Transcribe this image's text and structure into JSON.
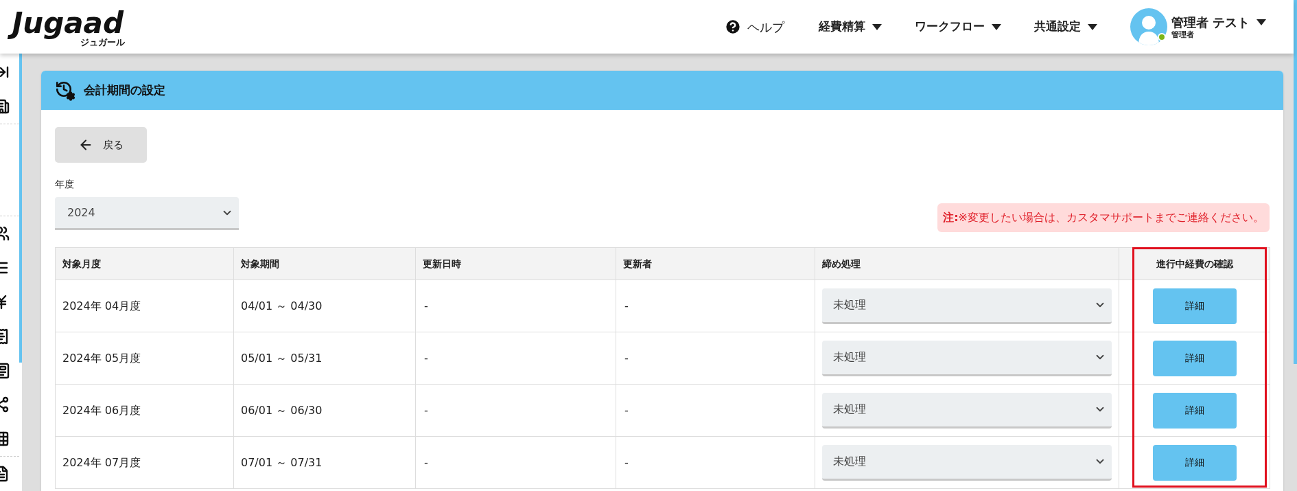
{
  "header": {
    "logo": "Jugaad",
    "logo_sub": "ジュガール",
    "help": "ヘルプ",
    "menus": [
      {
        "label": "経費精算"
      },
      {
        "label": "ワークフロー"
      },
      {
        "label": "共通設定"
      }
    ],
    "user": {
      "name": "管理者 テスト",
      "role": "管理者",
      "online": true
    }
  },
  "page": {
    "title": "会計期間の設定",
    "back": "戻る",
    "year": {
      "label": "年度",
      "value": "2024"
    },
    "note": "**注:**※変更したい場合は、カスタマサポートまでご連絡ください。"
  },
  "table": {
    "columns": [
      {
        "label": "対象月度",
        "highlighted": false
      },
      {
        "label": "対象期間",
        "highlighted": false
      },
      {
        "label": "更新日時",
        "highlighted": false
      },
      {
        "label": "更新者",
        "highlighted": false
      },
      {
        "label": "締め処理",
        "highlighted": false
      },
      {
        "label": "進行中経費の確認",
        "highlighted": true
      }
    ],
    "rows": [
      {
        "month": "2024年 04月度",
        "period": "04/01 ～ 04/30",
        "updated_at": "-",
        "updated_by": "-",
        "closing": "未処理",
        "action": "詳細"
      },
      {
        "month": "2024年 05月度",
        "period": "05/01 ～ 05/31",
        "updated_at": "-",
        "updated_by": "-",
        "closing": "未処理",
        "action": "詳細"
      },
      {
        "month": "2024年 06月度",
        "period": "06/01 ～ 06/30",
        "updated_at": "-",
        "updated_by": "-",
        "closing": "未処理",
        "action": "詳細"
      },
      {
        "month": "2024年 07月度",
        "period": "07/01 ～ 07/31",
        "updated_at": "-",
        "updated_by": "-",
        "closing": "未処理",
        "action": "詳細"
      }
    ]
  }
}
